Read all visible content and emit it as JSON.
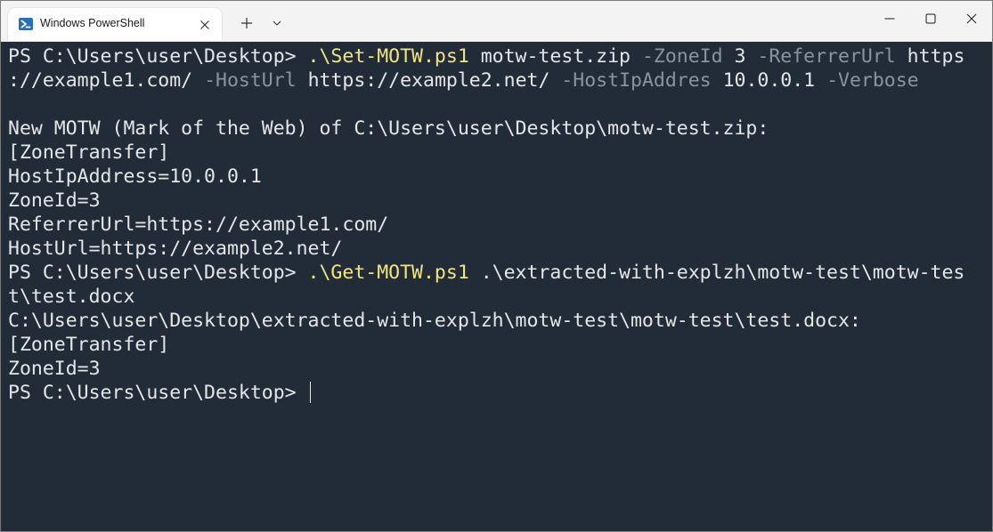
{
  "window": {
    "tab_title": "Windows PowerShell"
  },
  "colors": {
    "terminal_background": "#212c38",
    "text": "#e6e6e6",
    "command": "#f2e57f",
    "parameter": "#8b949d",
    "titlebar": "#f3f3f3"
  },
  "icons": {
    "tab": "powershell-icon",
    "tab_close": "close-icon",
    "new_tab": "plus-icon",
    "dropdown": "chevron-down-icon",
    "minimize": "minimize-icon",
    "maximize": "maximize-icon",
    "close": "close-icon"
  },
  "terminal": {
    "prompt": "PS C:\\Users\\user\\Desktop> ",
    "cmd1": {
      "command": ".\\Set-MOTW.ps1",
      "arg_file": " motw-test.zip ",
      "param_zone": "-ZoneId",
      "val_zone": " 3 ",
      "param_referrer": "-ReferrerUrl",
      "val_referrer_part1": " https",
      "val_referrer_part2": "://example1.com/ ",
      "param_hosturl": "-HostUrl",
      "val_hosturl": " https://example2.net/ ",
      "param_hostip": "-HostIpAddres",
      "val_hostip": " 10.0.0.1 ",
      "param_verbose": "-Verbose"
    },
    "output1": [
      "",
      "New MOTW (Mark of the Web) of C:\\Users\\user\\Desktop\\motw-test.zip:",
      "[ZoneTransfer]",
      "HostIpAddress=10.0.0.1",
      "ZoneId=3",
      "ReferrerUrl=https://example1.com/",
      "HostUrl=https://example2.net/"
    ],
    "cmd2": {
      "command": ".\\Get-MOTW.ps1",
      "arg_part1": " .\\extracted-with-explzh\\motw-test\\motw-tes",
      "arg_part2": "t\\test.docx"
    },
    "output2": [
      "C:\\Users\\user\\Desktop\\extracted-with-explzh\\motw-test\\motw-test\\test.docx:",
      "[ZoneTransfer]",
      "ZoneId=3"
    ]
  }
}
